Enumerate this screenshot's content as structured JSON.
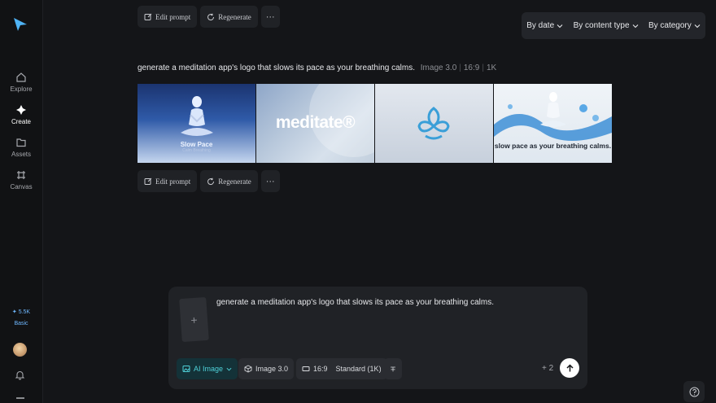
{
  "sidebar": {
    "items": [
      {
        "label": "Explore",
        "icon": "home-icon"
      },
      {
        "label": "Create",
        "icon": "sparkle-icon"
      },
      {
        "label": "Assets",
        "icon": "folder-icon"
      },
      {
        "label": "Canvas",
        "icon": "canvas-icon"
      }
    ],
    "credits": "✦ 5.5K",
    "plan": "Basic"
  },
  "filters": {
    "date": "By date",
    "content_type": "By content type",
    "category": "By category"
  },
  "actions": {
    "edit_prompt": "Edit prompt",
    "regenerate": "Regenerate",
    "more": "···"
  },
  "generation": {
    "prompt": "generate a meditation app's logo that slows its pace as your breathing calms.",
    "model": "Image 3.0",
    "ratio": "16:9",
    "resolution": "1K",
    "images": [
      {
        "title": "Slow Pace",
        "subtitle": "Calm Breathing"
      },
      {
        "title": "meditate®"
      },
      {
        "title": ""
      },
      {
        "title": "slow pace as your breathing calms."
      }
    ]
  },
  "composer": {
    "text": "generate a meditation app's logo that slows its pace as your breathing calms.",
    "upload_plus": "+",
    "ai_mode": "AI Image",
    "model": "Image 3.0",
    "ratio": "16:9",
    "quality": "Standard (1K)",
    "plus_count": "+ 2"
  },
  "colors": {
    "background": "#141518",
    "panel": "#202226",
    "accent": "#4fd1d9"
  }
}
